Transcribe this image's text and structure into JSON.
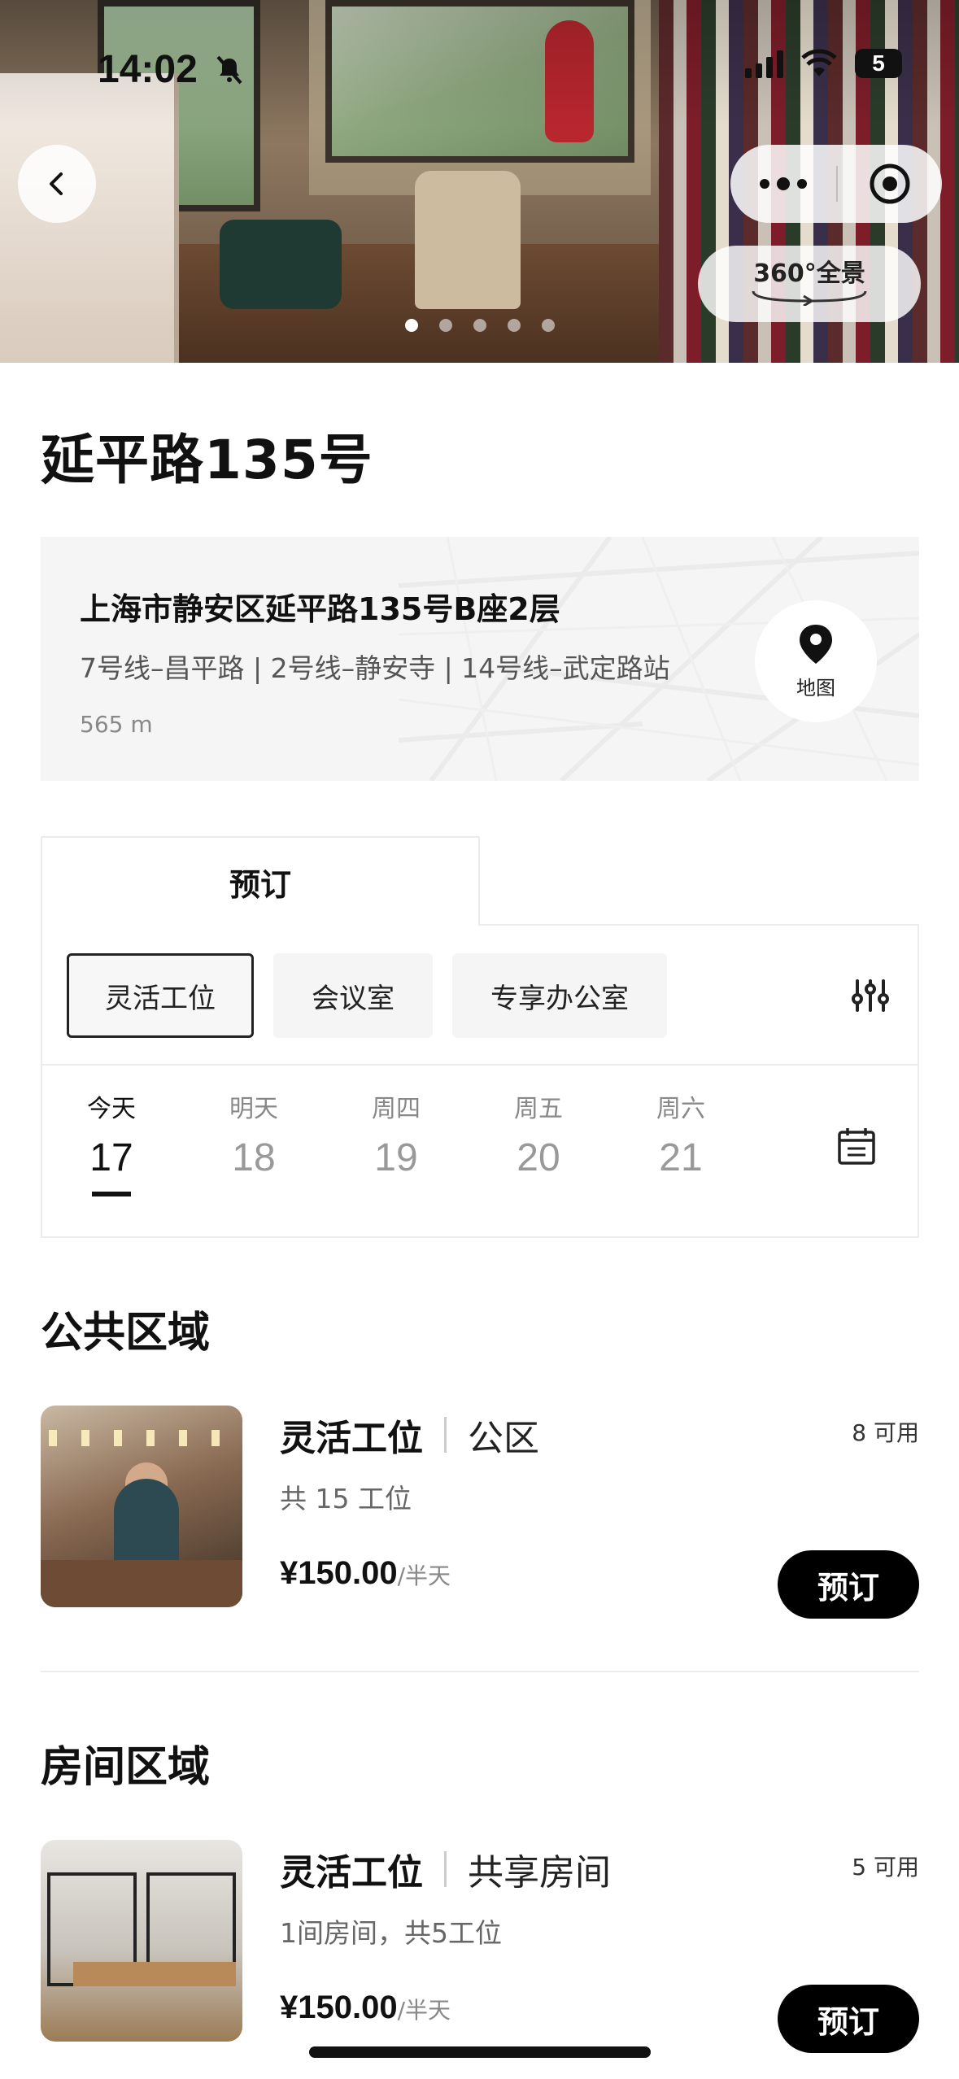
{
  "status_bar": {
    "time": "14:02",
    "battery": "5"
  },
  "hero": {
    "pano_label": "360°全景",
    "slide_count": 5,
    "active_slide": 0
  },
  "location": {
    "title": "延平路135号",
    "address": "上海市静安区延平路135号B座2层",
    "metro": "7号线–昌平路 | 2号线–静安寺 | 14号线–武定路站",
    "distance": "565 m",
    "map_label": "地图"
  },
  "booking": {
    "tab_label": "预订",
    "categories": [
      {
        "label": "灵活工位",
        "active": true
      },
      {
        "label": "会议室",
        "active": false
      },
      {
        "label": "专享办公室",
        "active": false
      }
    ],
    "dates": [
      {
        "weekday": "今天",
        "day": "17",
        "active": true
      },
      {
        "weekday": "明天",
        "day": "18",
        "active": false
      },
      {
        "weekday": "周四",
        "day": "19",
        "active": false
      },
      {
        "weekday": "周五",
        "day": "20",
        "active": false
      },
      {
        "weekday": "周六",
        "day": "21",
        "active": false
      }
    ]
  },
  "sections": {
    "public": {
      "title": "公共区域",
      "item": {
        "name": "灵活工位",
        "type": "公区",
        "available": "8 可用",
        "desc": "共 15 工位",
        "price": "¥150.00",
        "unit": "/半天",
        "book_label": "预订"
      }
    },
    "room": {
      "title": "房间区域",
      "item": {
        "name": "灵活工位",
        "type": "共享房间",
        "available": "5 可用",
        "desc": "1间房间，共5工位",
        "price": "¥150.00",
        "unit": "/半天",
        "book_label": "预订"
      }
    }
  },
  "colors": {
    "primary": "#000000",
    "chip_bg": "#f5f5f5",
    "card_bg": "#f5f5f5",
    "muted_text": "#888888"
  }
}
